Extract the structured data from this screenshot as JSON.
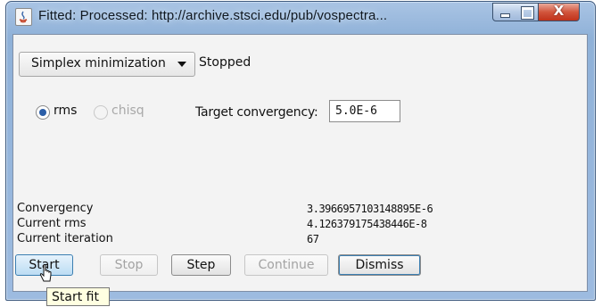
{
  "window": {
    "title": "Fitted:  Processed: http://archive.stsci.edu/pub/vospectra...",
    "controls": {
      "close_label": "X"
    }
  },
  "fit_method": {
    "selected": "Simplex minimization"
  },
  "status": "Stopped",
  "residual": {
    "options": [
      {
        "label": "rms",
        "selected": true,
        "enabled": true
      },
      {
        "label": "chisq",
        "selected": false,
        "enabled": false
      }
    ]
  },
  "convergence": {
    "label": "Target convergency:",
    "value": "5.0E-6"
  },
  "stats": [
    {
      "label": "Convergency",
      "value": "3.3966957103148895E-6"
    },
    {
      "label": "Current rms",
      "value": "4.126379175438446E-8"
    },
    {
      "label": "Current iteration",
      "value": "67"
    }
  ],
  "buttons": {
    "start": "Start",
    "stop": "Stop",
    "step": "Step",
    "continue": "Continue",
    "dismiss": "Dismiss"
  },
  "tooltip": "Start fit",
  "icons": {
    "app": "java-icon",
    "minimize": "minimize-icon",
    "maximize": "maximize-icon",
    "close": "close-icon",
    "dropdown": "chevron-down-icon",
    "cursor": "mouse-pointer-icon"
  }
}
